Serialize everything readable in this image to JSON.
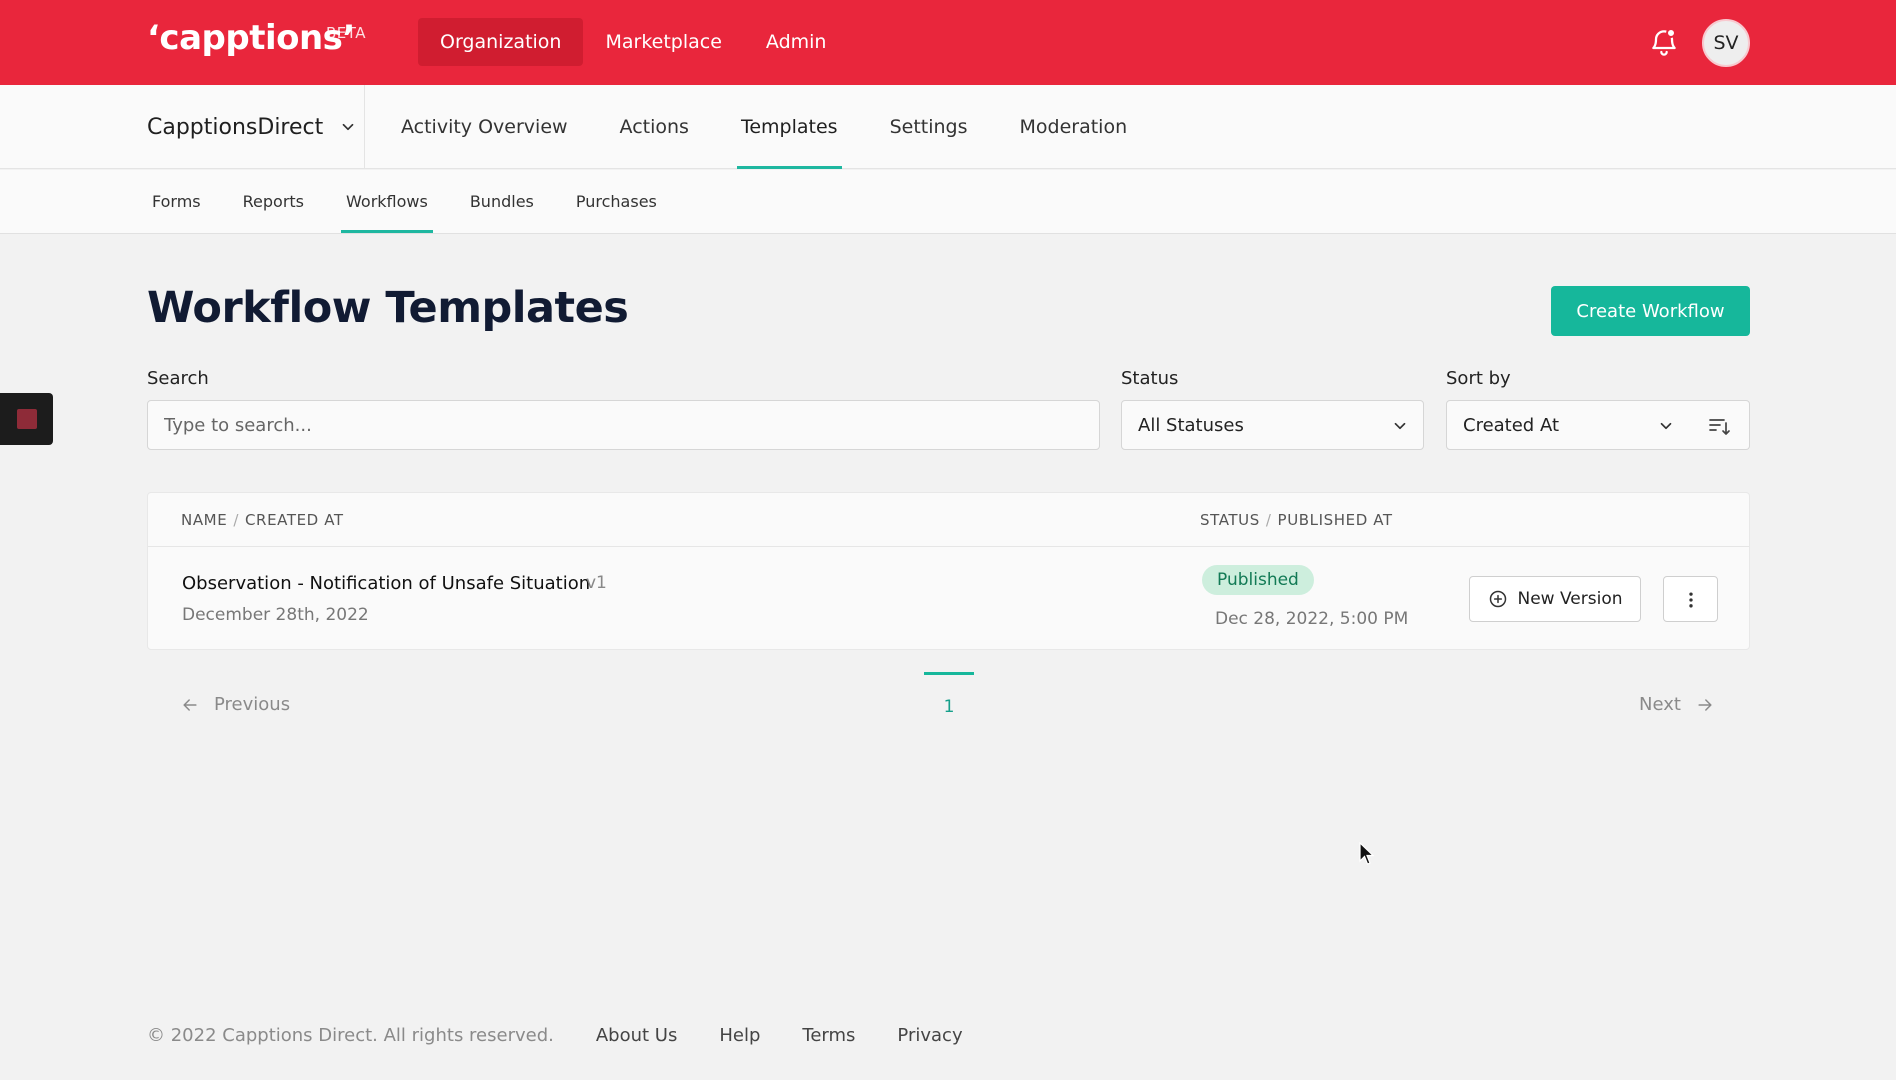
{
  "app": {
    "logo": "‘capptions’",
    "beta": "BETA",
    "user_initials": "SV"
  },
  "topnav": {
    "items": [
      {
        "label": "Organization",
        "active": true
      },
      {
        "label": "Marketplace",
        "active": false
      },
      {
        "label": "Admin",
        "active": false
      }
    ]
  },
  "org": {
    "name": "CapptionsDirect"
  },
  "subnav": {
    "items": [
      {
        "label": "Activity Overview"
      },
      {
        "label": "Actions"
      },
      {
        "label": "Templates",
        "active": true
      },
      {
        "label": "Settings"
      },
      {
        "label": "Moderation"
      }
    ]
  },
  "tabs": {
    "items": [
      {
        "label": "Forms"
      },
      {
        "label": "Reports"
      },
      {
        "label": "Workflows",
        "active": true
      },
      {
        "label": "Bundles"
      },
      {
        "label": "Purchases"
      }
    ]
  },
  "page": {
    "title": "Workflow Templates",
    "create_button": "Create Workflow"
  },
  "filters": {
    "search_label": "Search",
    "search_placeholder": "Type to search...",
    "status_label": "Status",
    "status_value": "All Statuses",
    "sort_label": "Sort by",
    "sort_value": "Created At"
  },
  "table": {
    "col1_a": "Name",
    "col1_b": "Created At",
    "col2_a": "Status",
    "col2_b": "Published At",
    "rows": [
      {
        "name": "Observation - Notification of Unsafe Situation",
        "version": "v1",
        "created": "December 28th, 2022",
        "status": "Published",
        "published": "Dec 28, 2022, 5:00 PM",
        "new_version_label": "New Version"
      }
    ]
  },
  "pagination": {
    "previous": "Previous",
    "current": "1",
    "next": "Next"
  },
  "footer": {
    "copyright": "© 2022 Capptions Direct. All rights reserved.",
    "links": [
      "About Us",
      "Help",
      "Terms",
      "Privacy"
    ]
  },
  "colors": {
    "brand_red": "#e9263c",
    "accent_teal": "#16b79b",
    "badge_green_bg": "#cdeedd",
    "badge_green_text": "#127a55"
  },
  "icons": [
    "bell-icon",
    "chevron-down-icon",
    "sort-direction-icon",
    "plus-circle-icon",
    "kebab-menu-icon",
    "arrow-left-icon",
    "arrow-right-icon"
  ]
}
